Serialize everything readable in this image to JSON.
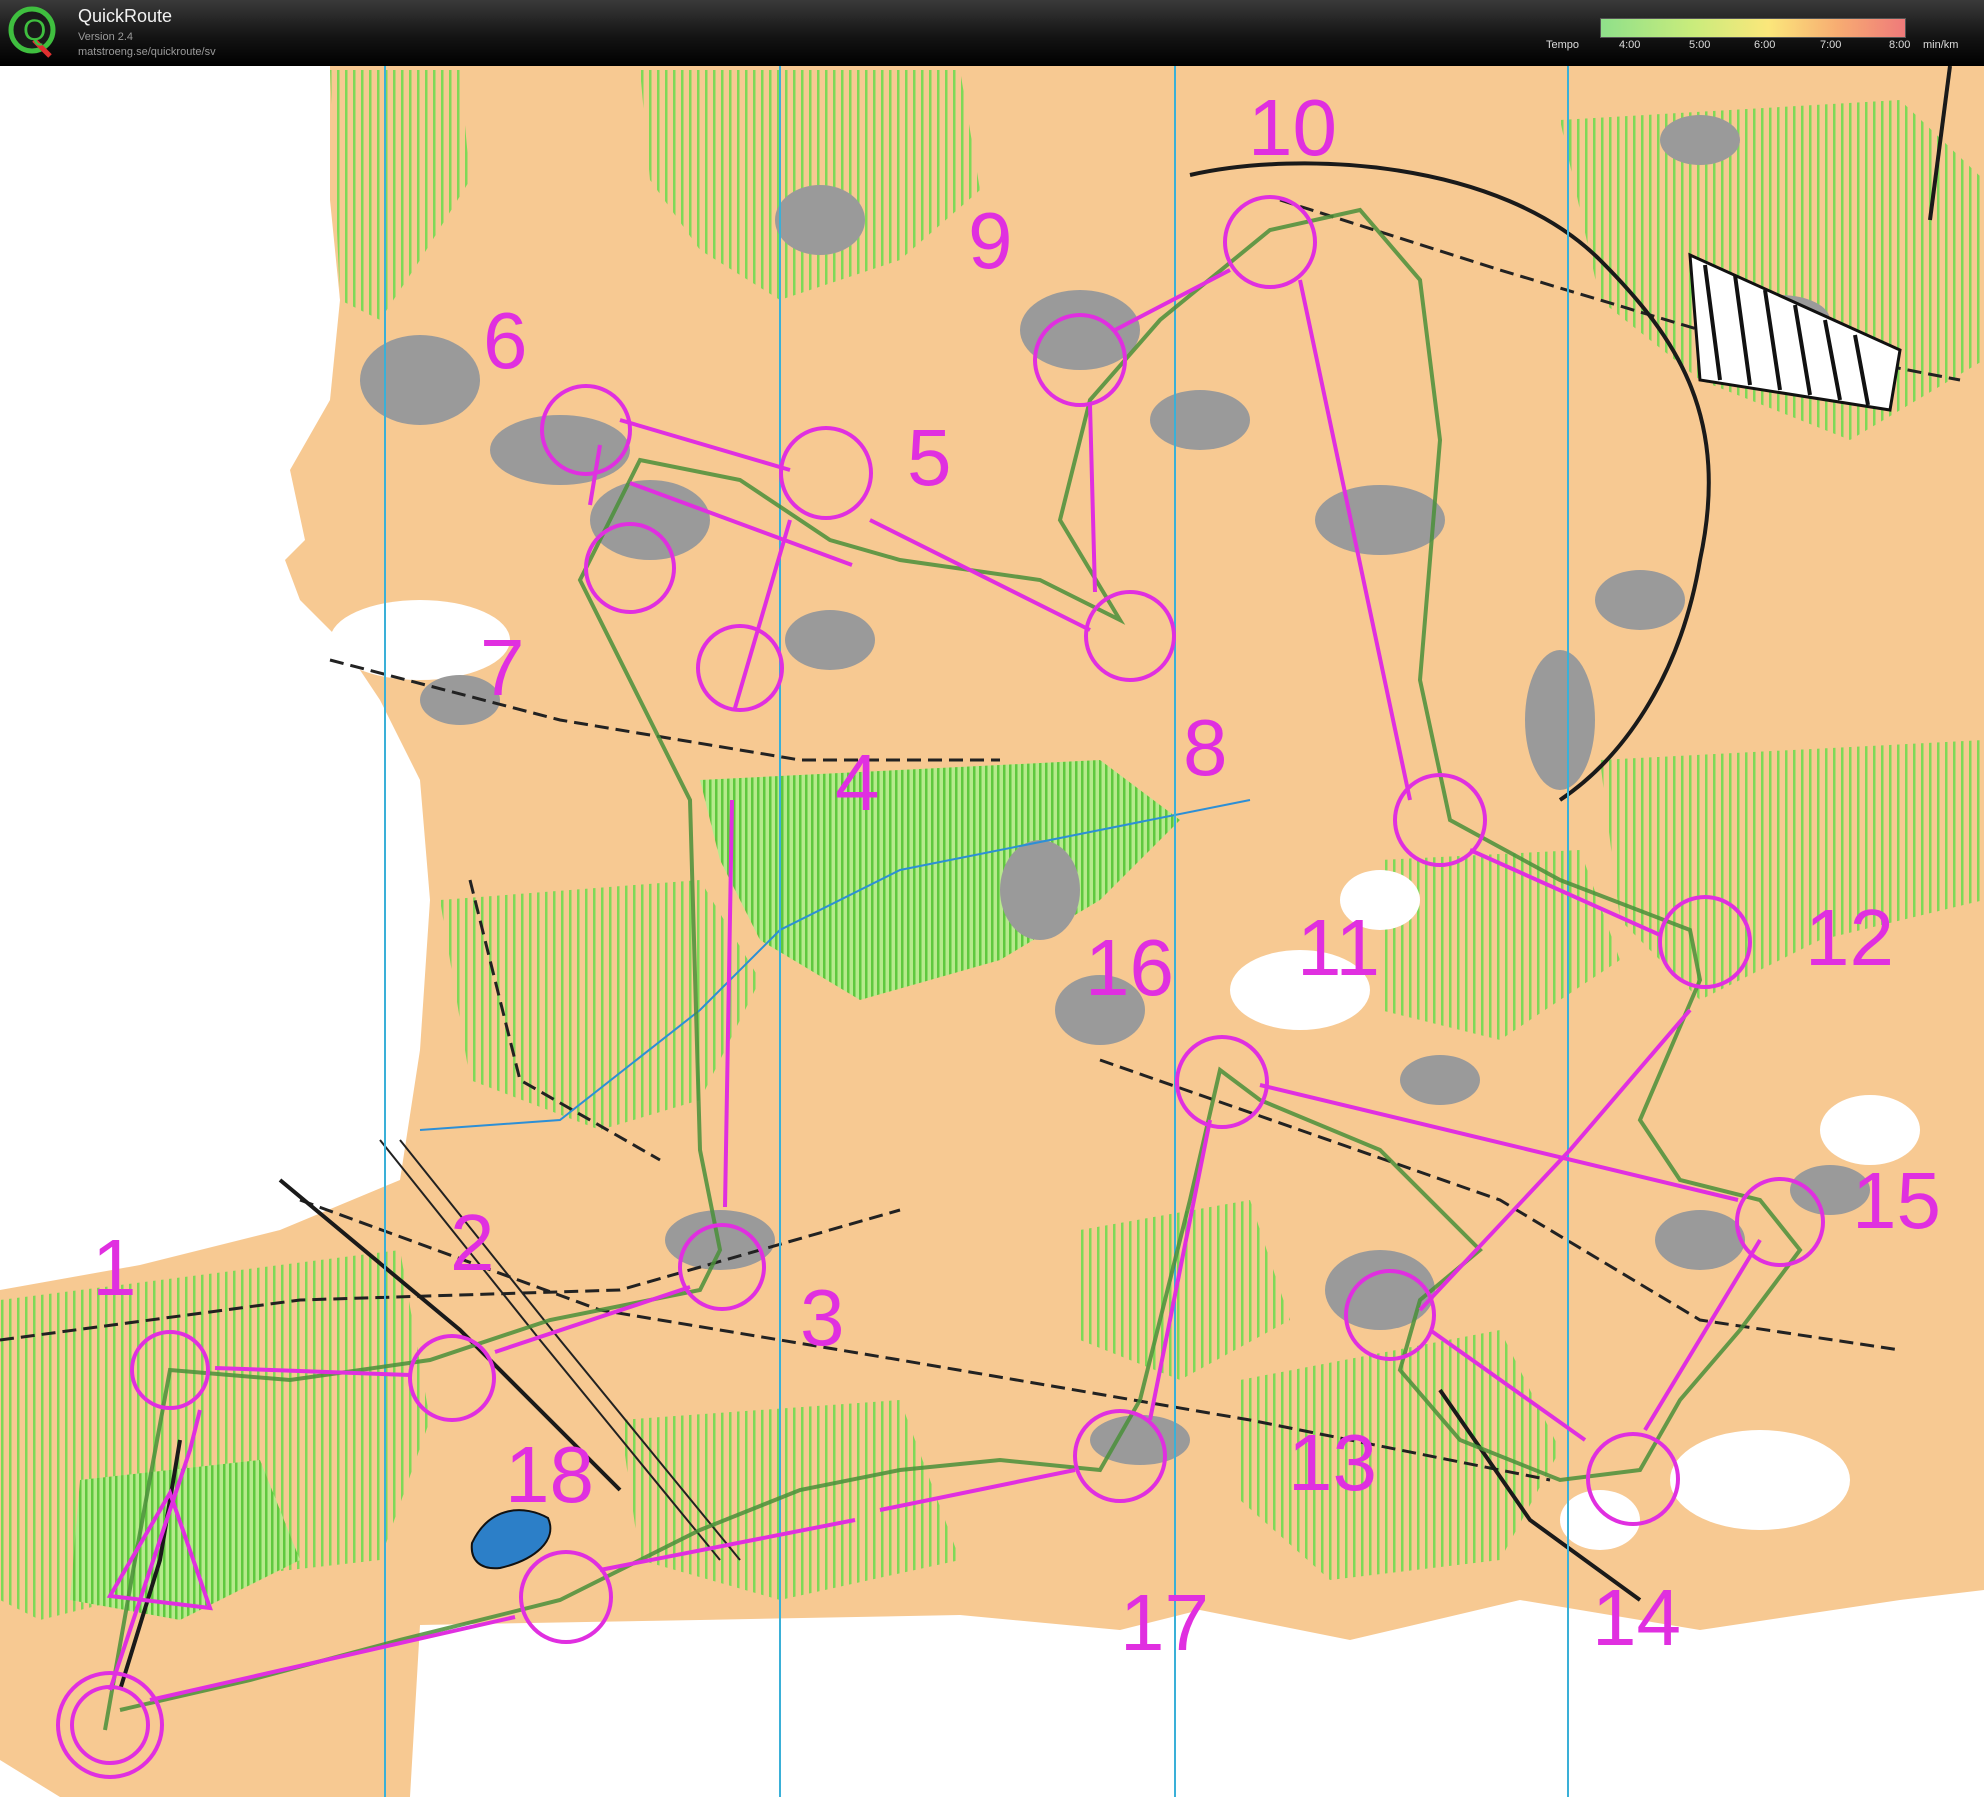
{
  "app": {
    "name": "QuickRoute",
    "version": "Version 2.4",
    "url": "matstroeng.se/quickroute/sv",
    "logo_letter": "Q"
  },
  "tempo": {
    "label": "Tempo",
    "ticks": [
      "4:00",
      "5:00",
      "6:00",
      "7:00",
      "8:00"
    ],
    "unit": "min/km",
    "colors": [
      "#8fe08a",
      "#c9ec7c",
      "#fbe77b",
      "#f7ac72",
      "#ef7a7a"
    ]
  },
  "map": {
    "course_color": "#e02fe0",
    "route_color": "#4a8f3a",
    "meridian_color": "#3ab0d8",
    "terrain_color": "#f7c992",
    "vegetation_color": "#7ed957",
    "rock_color": "#9a9a9a",
    "control_labels": [
      "1",
      "2",
      "3",
      "4",
      "5",
      "6",
      "7",
      "8",
      "9",
      "10",
      "11",
      "12",
      "13",
      "14",
      "15",
      "16",
      "17",
      "18"
    ]
  }
}
